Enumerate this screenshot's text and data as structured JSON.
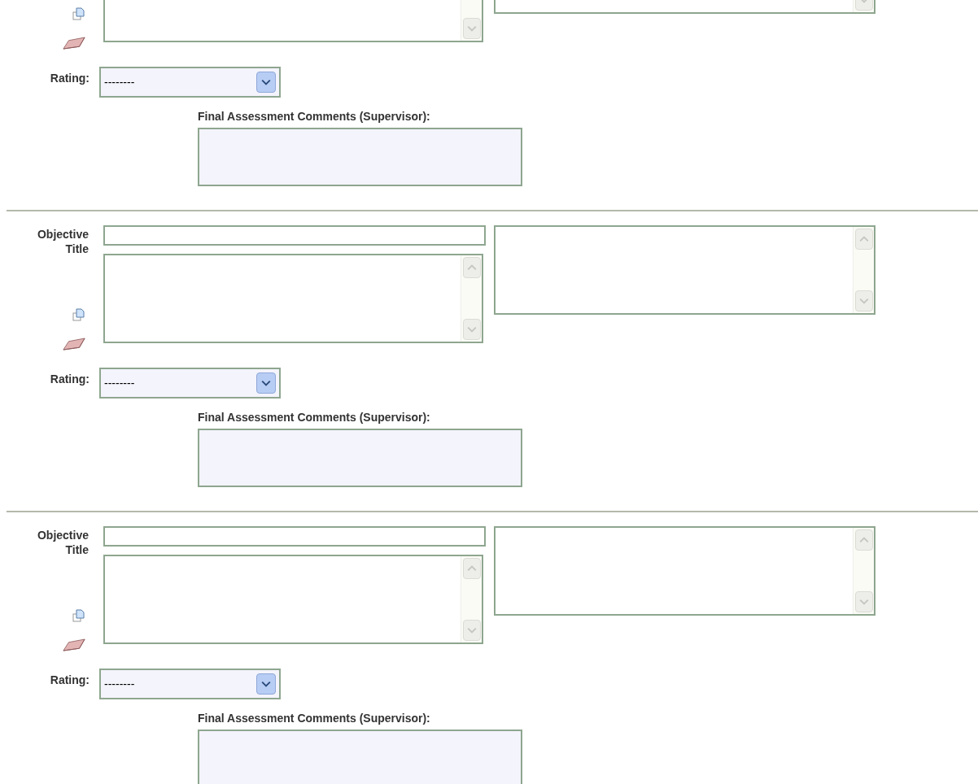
{
  "sections": [
    {
      "rating_label": "Rating:",
      "rating_value": "--------",
      "comments_label": "Final Assessment Comments (Supervisor):"
    },
    {
      "title_label": "Objective Title",
      "rating_label": "Rating:",
      "rating_value": "--------",
      "comments_label": "Final Assessment Comments (Supervisor):"
    },
    {
      "title_label": "Objective Title",
      "rating_label": "Rating:",
      "rating_value": "--------",
      "comments_label": "Final Assessment Comments (Supervisor):"
    }
  ]
}
